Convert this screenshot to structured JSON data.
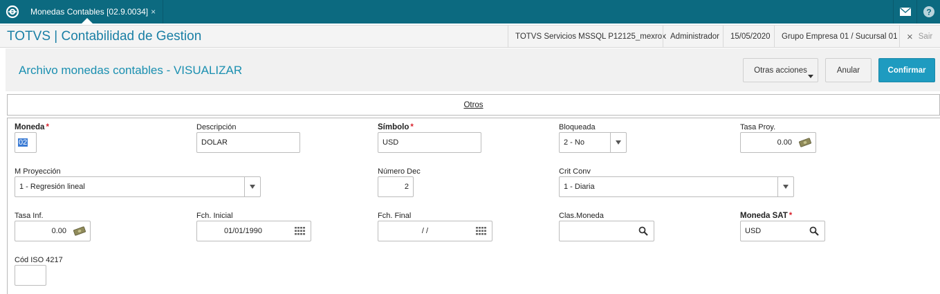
{
  "topbar": {
    "tab_label": "Monedas Contables [02.9.0034]",
    "tab_close": "×",
    "icons": [
      "totvs-logo-icon",
      "mail-icon",
      "help-icon"
    ]
  },
  "titlebar": {
    "app_title": "TOTVS | Contabilidad de Gestion",
    "environment": "TOTVS Servicios MSSQL P12125_mexrox",
    "user": "Administrador",
    "date": "15/05/2020",
    "company": "Grupo Empresa 01 / Sucursal 01",
    "exit_label": "Sair",
    "exit_icon": "×"
  },
  "header": {
    "page_title": "Archivo monedas contables - VISUALIZAR",
    "other_actions": "Otras acciones",
    "cancel": "Anular",
    "confirm": "Confirmar"
  },
  "folder": {
    "tab_label": "Otros"
  },
  "form": {
    "moneda": {
      "label": "Moneda",
      "required": "*",
      "value": "02"
    },
    "descripcion": {
      "label": "Descripción",
      "value": "DOLAR"
    },
    "simbolo": {
      "label": "Símbolo",
      "required": "*",
      "value": "USD"
    },
    "bloqueada": {
      "label": "Bloqueada",
      "value": "2 - No"
    },
    "tasa_proy": {
      "label": "Tasa Proy.",
      "value": "0.00"
    },
    "m_proyeccion": {
      "label": "M Proyección",
      "value": "1 - Regresión lineal"
    },
    "numero_dec": {
      "label": "Número Dec",
      "value": "2"
    },
    "crit_conv": {
      "label": "Crit Conv",
      "value": "1 - Diaria"
    },
    "tasa_inf": {
      "label": "Tasa Inf.",
      "value": "0.00"
    },
    "fch_inicial": {
      "label": "Fch. Inicial",
      "value": "01/01/1990"
    },
    "fch_final": {
      "label": "Fch. Final",
      "value": "/  /"
    },
    "clas_moneda": {
      "label": "Clas.Moneda",
      "value": ""
    },
    "moneda_sat": {
      "label": "Moneda SAT",
      "required": "*",
      "value": "USD"
    },
    "cod_iso": {
      "label": "Cód ISO 4217",
      "value": ""
    }
  },
  "colors": {
    "topbar": "#0c6a80",
    "accent": "#1a8fb0",
    "confirm_button": "#1e9bc0",
    "required": "#d9232d"
  }
}
